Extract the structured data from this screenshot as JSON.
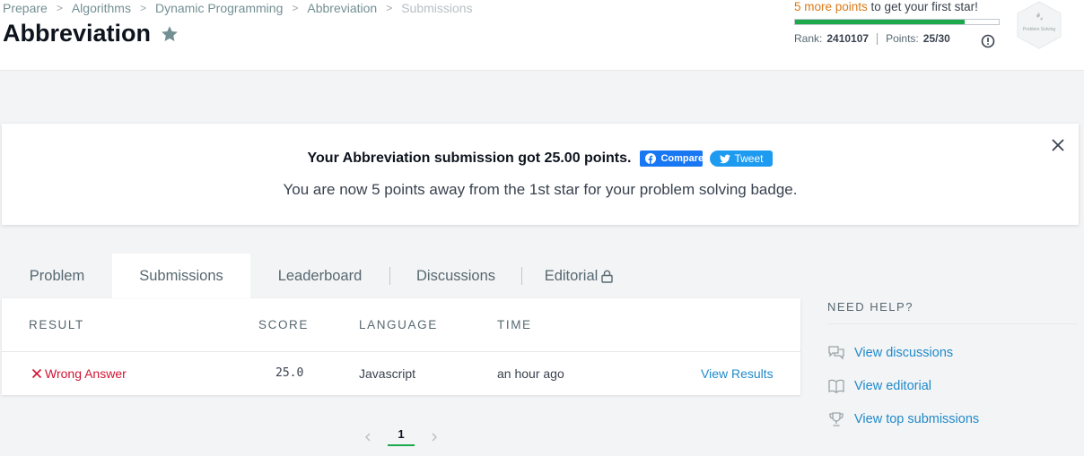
{
  "breadcrumb": [
    "Prepare",
    "Algorithms",
    "Dynamic Programming",
    "Abbreviation",
    "Submissions"
  ],
  "header": {
    "title": "Abbreviation",
    "progress": {
      "accent_text": "5 more points",
      "rest_text": " to get your first star!",
      "fraction": 0.8333
    },
    "rank_label": "Rank:",
    "rank_value": "2410107",
    "points_label": "Points:",
    "points_value": "25/30",
    "badge_label": "Problem Solving"
  },
  "banner": {
    "message": "Your Abbreviation submission got 25.00 points.",
    "facebook_label": "Compare",
    "tweet_label": "Tweet",
    "subtext": "You are now 5 points away from the 1st star for your problem solving badge."
  },
  "tabs": [
    {
      "label": "Problem"
    },
    {
      "label": "Submissions"
    },
    {
      "label": "Leaderboard"
    },
    {
      "label": "Discussions"
    },
    {
      "label": "Editorial"
    }
  ],
  "table": {
    "headers": [
      "RESULT",
      "SCORE",
      "LANGUAGE",
      "TIME"
    ],
    "row": {
      "result": "Wrong Answer",
      "score": "25.0",
      "language": "Javascript",
      "time": "an hour ago",
      "action": "View Results"
    }
  },
  "pagination": {
    "current": "1"
  },
  "help": {
    "title": "NEED HELP?",
    "links": [
      "View discussions",
      "View editorial",
      "View top submissions"
    ]
  },
  "colors": {
    "accent_orange": "#d87a16",
    "progress_green": "#1ba94c",
    "error_red": "#d11534",
    "link_blue": "#1f8acb",
    "facebook_blue": "#1877f2",
    "twitter_blue": "#1d9bf0"
  }
}
